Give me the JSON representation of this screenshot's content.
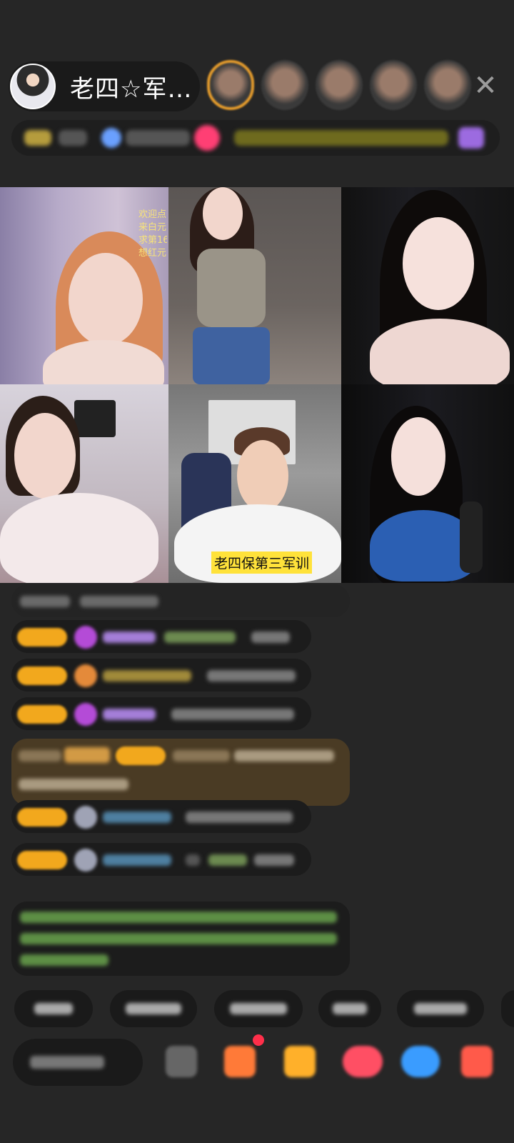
{
  "header": {
    "host_name": "老四☆军…",
    "close_glyph": "✕",
    "viewer_count": 5
  },
  "grid": {
    "overlay_lines": [
      "欢迎点",
      "来白元",
      "求第16",
      "想红元"
    ],
    "caption": "老四保第三军训"
  },
  "colors": {
    "background": "#262626",
    "badge": "#f2a81d",
    "welcome_bg": "#4a3b24",
    "accent_pink": "#ff3f74",
    "caption_bg": "#ffe23a"
  },
  "icons": [
    "gift-icon",
    "emoji-icon",
    "game-icon",
    "share-icon",
    "more-icon"
  ]
}
